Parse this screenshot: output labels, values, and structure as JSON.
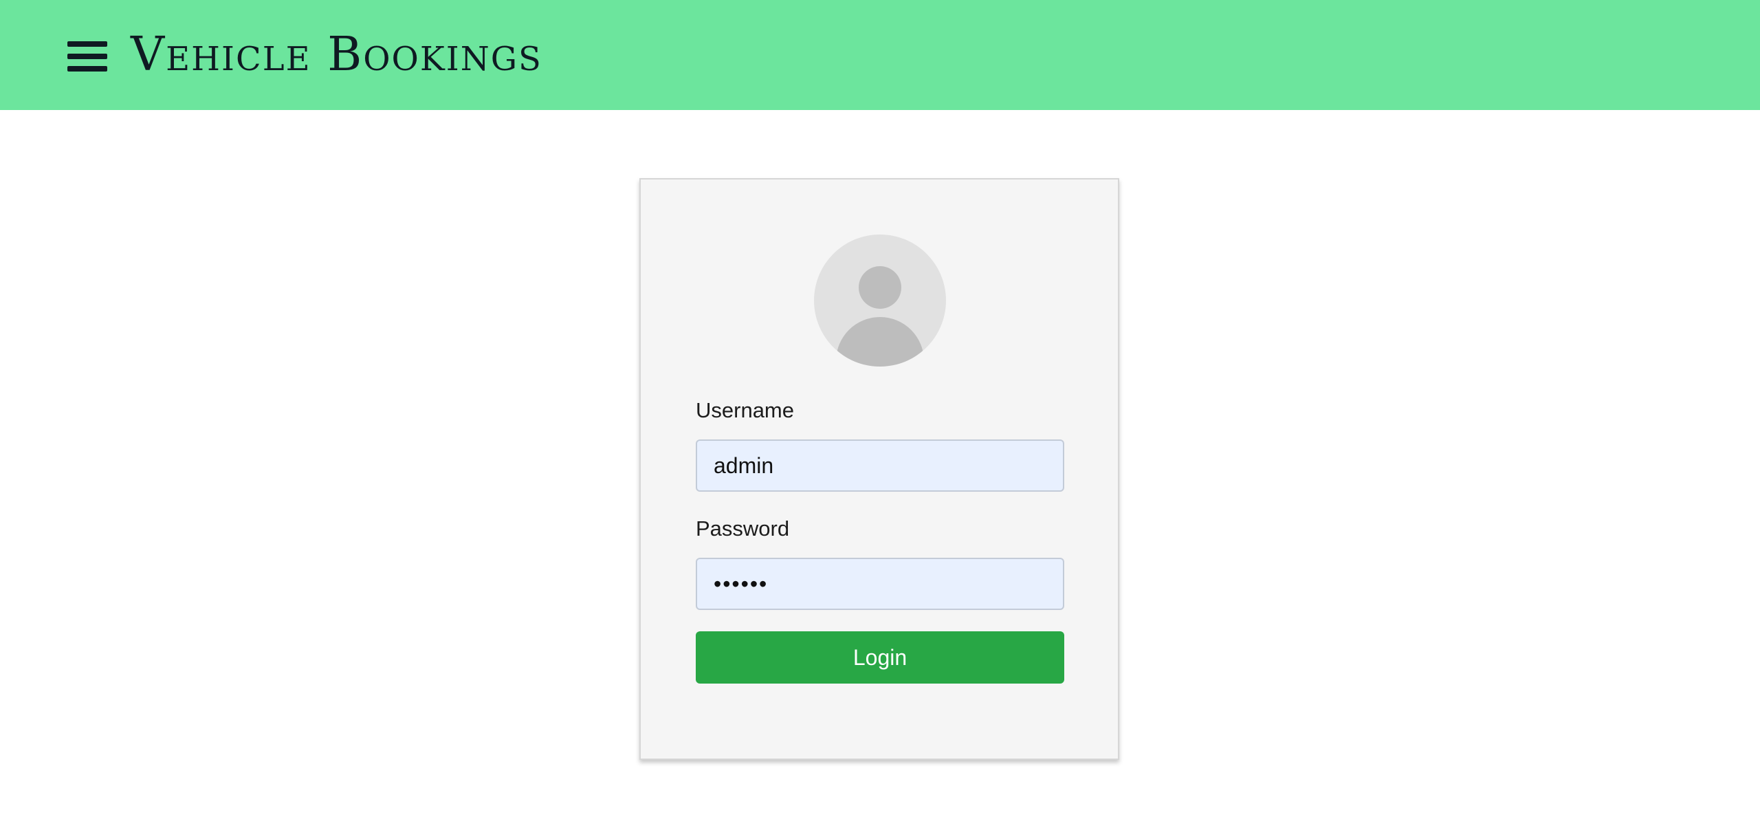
{
  "header": {
    "title": "Vehicle Bookings",
    "menu_icon": "hamburger-menu-icon",
    "background_color": "#6ce59d"
  },
  "login": {
    "avatar_icon": "user-avatar-icon",
    "username_label": "Username",
    "username_value": "admin",
    "password_label": "Password",
    "password_value": "••••••",
    "login_label": "Login",
    "button_color": "#28a745"
  }
}
